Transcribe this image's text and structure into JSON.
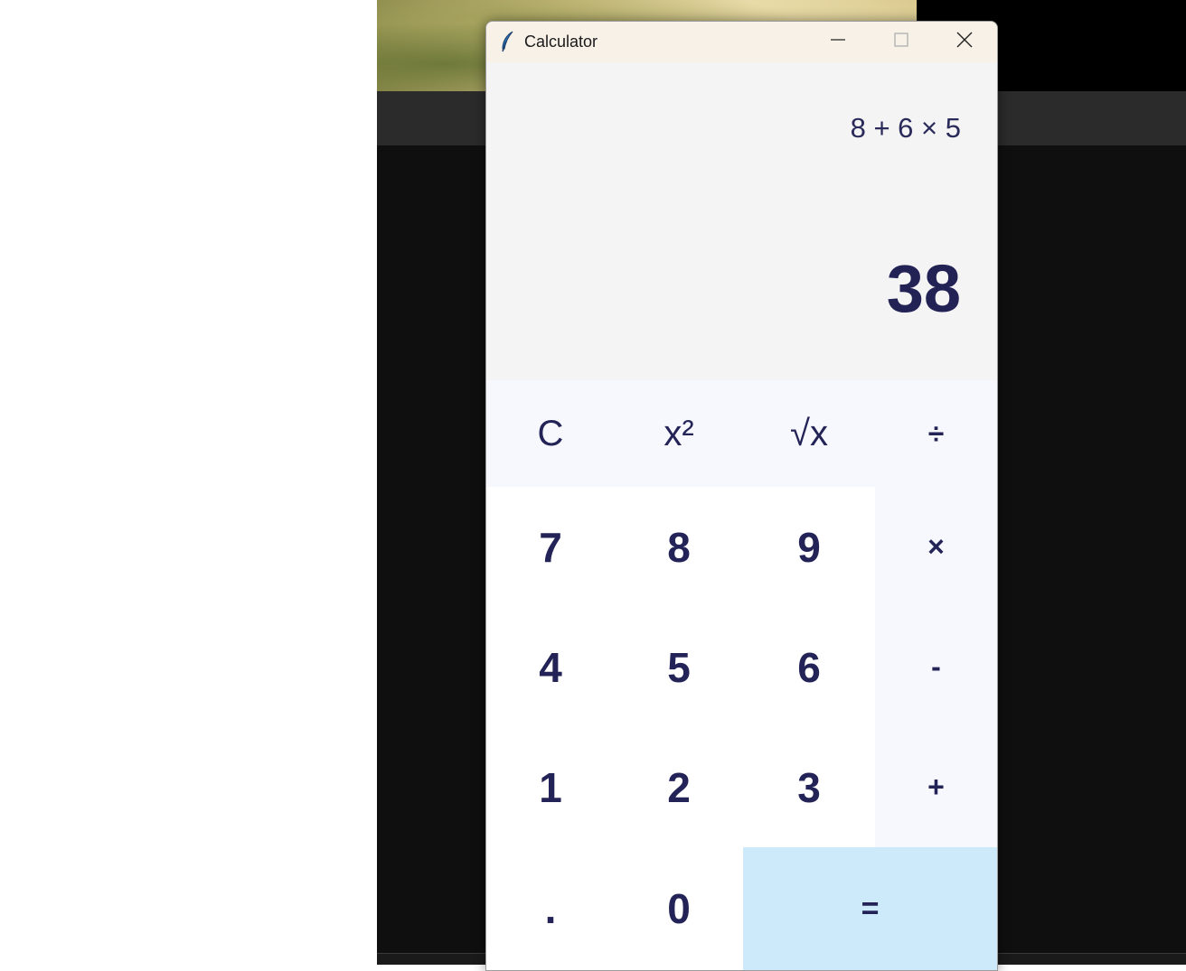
{
  "window": {
    "title": "Calculator",
    "controls": {
      "minimize": "minimize-icon",
      "maximize": "maximize-icon",
      "close": "close-icon"
    },
    "app_icon": "feather-icon"
  },
  "display": {
    "expression": "8 + 6 × 5",
    "result": "38"
  },
  "keypad": {
    "row1": [
      "C",
      "x²",
      "√x",
      "÷"
    ],
    "row2": [
      "7",
      "8",
      "9",
      "×"
    ],
    "row3": [
      "4",
      "5",
      "6",
      "-"
    ],
    "row4": [
      "1",
      "2",
      "3",
      "+"
    ],
    "row5": [
      ".",
      "0",
      "="
    ]
  },
  "colors": {
    "text": "#232357",
    "display_bg": "#f4f4f4",
    "function_bg": "#f7f8fd",
    "equals_bg": "#cdeafb",
    "titlebar_bg": "#f7f1e7"
  }
}
